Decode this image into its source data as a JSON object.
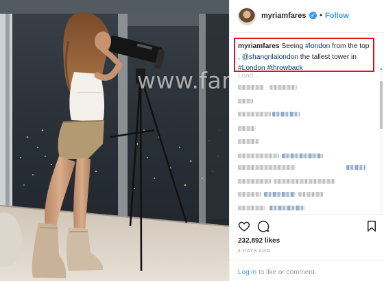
{
  "photo": {
    "watermark": "www.farfesh.com"
  },
  "header": {
    "username": "myriamfares",
    "verified_glyph": "✓",
    "separator": "•",
    "follow_label": "Follow"
  },
  "caption": {
    "username": "myriamfares",
    "parts": {
      "p1": "Seeing ",
      "tag1": "#london",
      "p2": " from the top ,",
      "tag2": "@shangrilalondon",
      "p3": " the tallest tower in ",
      "tag3": "#London",
      "p4": " ",
      "tag4": "#throwback"
    }
  },
  "comments": {
    "loading_text": "Load..."
  },
  "actions": {
    "like_icon": "heart-icon",
    "comment_icon": "comment-icon",
    "save_icon": "bookmark-icon",
    "likes": "232,892 likes",
    "time_ago": "4 DAYS AGO",
    "login_link": "Log in",
    "login_rest": " to like or comment."
  },
  "colors": {
    "accent": "#3897f0",
    "caption_highlight": "#d9131a",
    "hashtag": "#003569"
  }
}
